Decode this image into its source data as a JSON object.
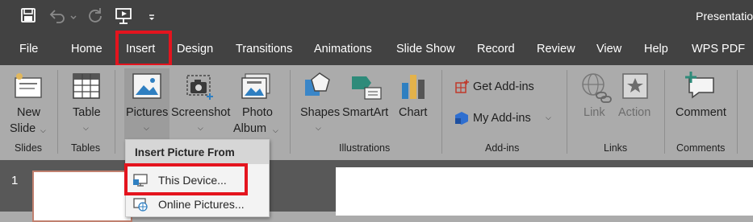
{
  "titlebar": {
    "title": "Presentatio",
    "icons": [
      "save-icon",
      "undo-icon",
      "undo-dropdown-icon",
      "redo-icon",
      "present-from-beginning-icon",
      "customize-quick-access-icon"
    ]
  },
  "tabs": [
    {
      "label": "File"
    },
    {
      "label": "Home"
    },
    {
      "label": "Insert",
      "active": true
    },
    {
      "label": "Design"
    },
    {
      "label": "Transitions"
    },
    {
      "label": "Animations"
    },
    {
      "label": "Slide Show"
    },
    {
      "label": "Record"
    },
    {
      "label": "Review"
    },
    {
      "label": "View"
    },
    {
      "label": "Help"
    },
    {
      "label": "WPS PDF"
    }
  ],
  "ribbon": {
    "slides": {
      "new_slide": "New",
      "new_slide_2": "Slide",
      "group": "Slides"
    },
    "tables": {
      "table": "Table",
      "group": "Tables"
    },
    "images": {
      "pictures": "Pictures",
      "screenshot": "Screenshot",
      "photo_album": "Photo",
      "photo_album_2": "Album"
    },
    "illustrations": {
      "shapes": "Shapes",
      "smartart": "SmartArt",
      "chart": "Chart",
      "group": "Illustrations"
    },
    "addins": {
      "get_addins": "Get Add-ins",
      "my_addins": "My Add-ins",
      "group": "Add-ins"
    },
    "links": {
      "link": "Link",
      "action": "Action",
      "group": "Links"
    },
    "comments": {
      "comment": "Comment",
      "group": "Comments"
    }
  },
  "dropdown": {
    "header": "Insert Picture From",
    "items": [
      {
        "label": "This Device...",
        "icon": "this-device-icon",
        "highlighted": true
      },
      {
        "label": "Online Pictures...",
        "icon": "online-pictures-icon"
      }
    ]
  },
  "slide_panel": {
    "slide_number": "1"
  },
  "colors": {
    "highlight": "#e4141e",
    "tabbar": "#424242",
    "ribbon": "#ababab",
    "workspace": "#585858"
  }
}
